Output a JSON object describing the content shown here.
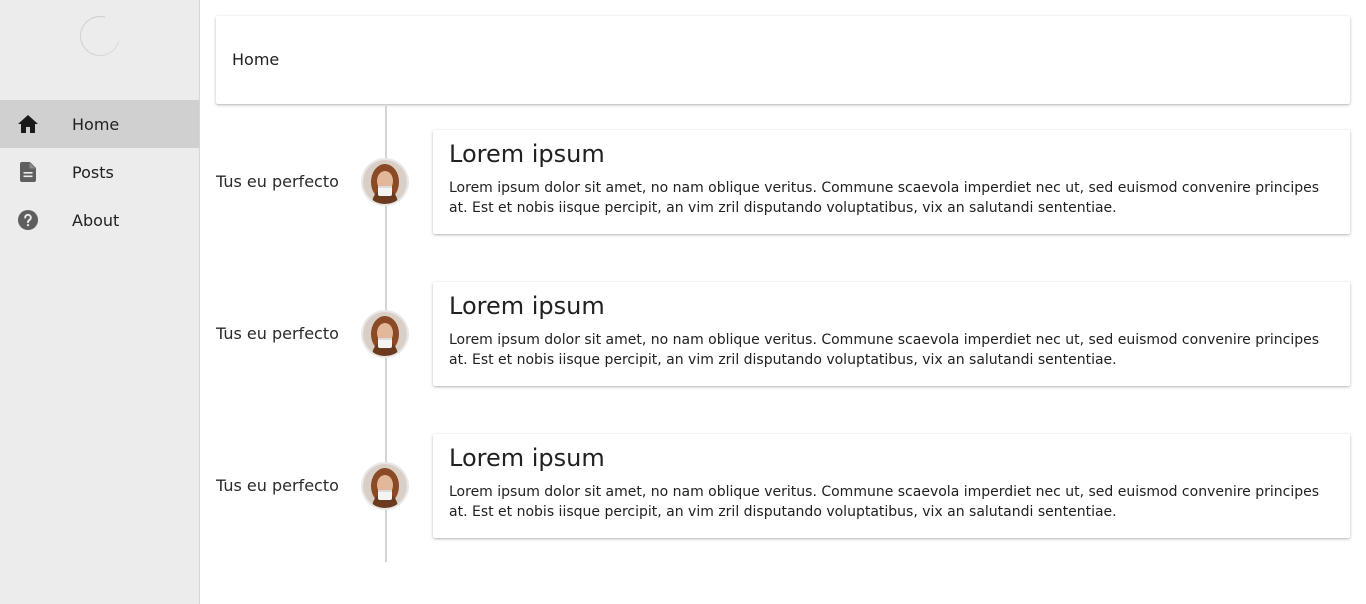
{
  "sidebar": {
    "items": [
      {
        "label": "Home",
        "icon": "home-icon",
        "active": true
      },
      {
        "label": "Posts",
        "icon": "document-icon",
        "active": false
      },
      {
        "label": "About",
        "icon": "help-icon",
        "active": false
      }
    ]
  },
  "header": {
    "title": "Home"
  },
  "timeline": {
    "items": [
      {
        "date": "Tus eu perfecto",
        "title": "Lorem ipsum",
        "body": "Lorem ipsum dolor sit amet, no nam oblique veritus. Commune scaevola imperdiet nec ut, sed euismod convenire principes at. Est et nobis iisque percipit, an vim zril disputando voluptatibus, vix an salutandi sententiae."
      },
      {
        "date": "Tus eu perfecto",
        "title": "Lorem ipsum",
        "body": "Lorem ipsum dolor sit amet, no nam oblique veritus. Commune scaevola imperdiet nec ut, sed euismod convenire principes at. Est et nobis iisque percipit, an vim zril disputando voluptatibus, vix an salutandi sententiae."
      },
      {
        "date": "Tus eu perfecto",
        "title": "Lorem ipsum",
        "body": "Lorem ipsum dolor sit amet, no nam oblique veritus. Commune scaevola imperdiet nec ut, sed euismod convenire principes at. Est et nobis iisque percipit, an vim zril disputando voluptatibus, vix an salutandi sententiae."
      }
    ]
  },
  "colors": {
    "sidebar_bg": "#ececec",
    "active_item_bg": "#d0d0d0",
    "timeline_line": "#d4d4d4"
  }
}
